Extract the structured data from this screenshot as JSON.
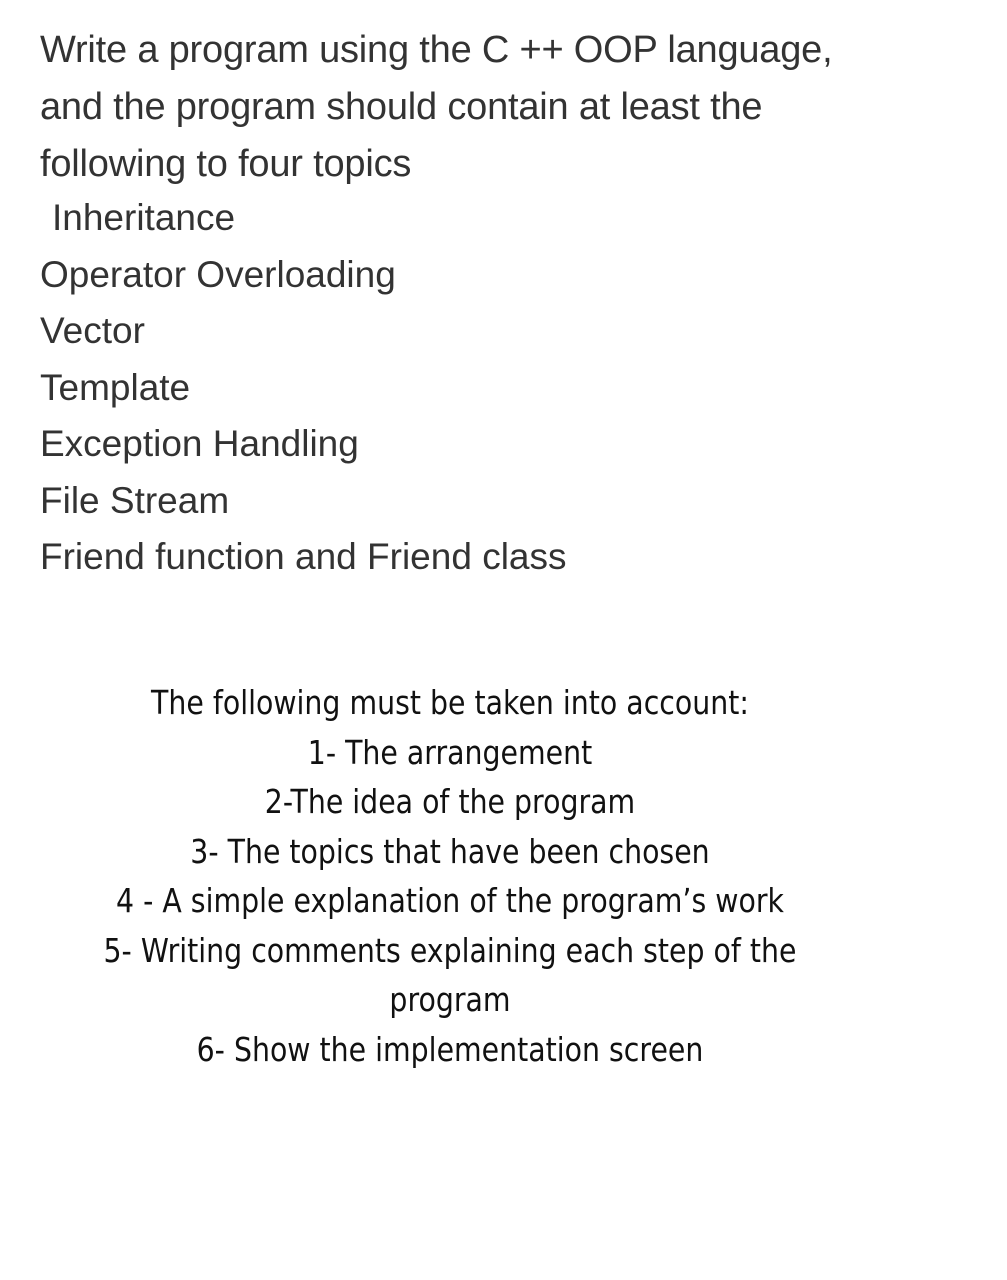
{
  "intro": {
    "lines": [
      "Write a program using the C ++ OOP language,",
      "and the program should contain at least the",
      "following to four topics"
    ]
  },
  "topics": [
    "Inheritance",
    "Operator Overloading",
    "Vector",
    "Template",
    "Exception Handling",
    "File Stream",
    "Friend function and Friend class"
  ],
  "requirements": {
    "heading": "The following must be taken into account:",
    "items": [
      "1- The arrangement",
      "2-The idea of the program",
      "3- The topics that have been chosen",
      "4 - A simple explanation of the program’s work",
      "5- Writing comments explaining each step of the program",
      "6- Show the implementation screen"
    ]
  }
}
